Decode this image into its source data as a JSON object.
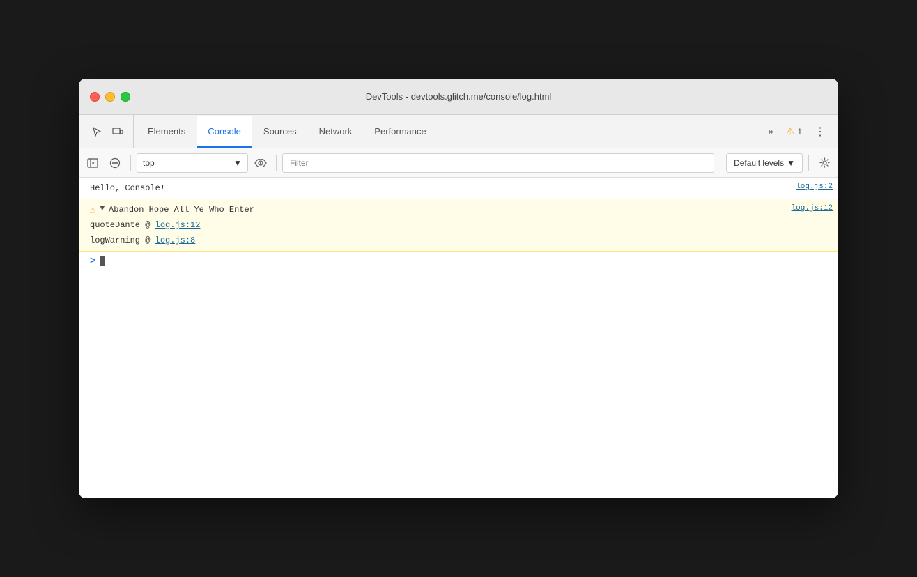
{
  "window": {
    "title": "DevTools - devtools.glitch.me/console/log.html"
  },
  "traffic_lights": {
    "close": "close",
    "minimize": "minimize",
    "maximize": "maximize"
  },
  "tabs": [
    {
      "label": "Elements",
      "active": false
    },
    {
      "label": "Console",
      "active": true
    },
    {
      "label": "Sources",
      "active": false
    },
    {
      "label": "Network",
      "active": false
    },
    {
      "label": "Performance",
      "active": false
    }
  ],
  "more_button": "»",
  "warning_count": "1",
  "toolbar": {
    "context_label": "top",
    "filter_placeholder": "Filter",
    "levels_label": "Default levels",
    "levels_arrow": "▼"
  },
  "console_entries": [
    {
      "type": "log",
      "text": "Hello, Console!",
      "source": "log.js:2"
    },
    {
      "type": "warning",
      "expanded": true,
      "text": "Abandon Hope All Ye Who Enter",
      "source": "log.js:12",
      "stack": [
        {
          "text": "quoteDante @ ",
          "link": "log.js:12"
        },
        {
          "text": "logWarning @ ",
          "link": "log.js:8"
        }
      ]
    }
  ],
  "prompt_symbol": ">"
}
